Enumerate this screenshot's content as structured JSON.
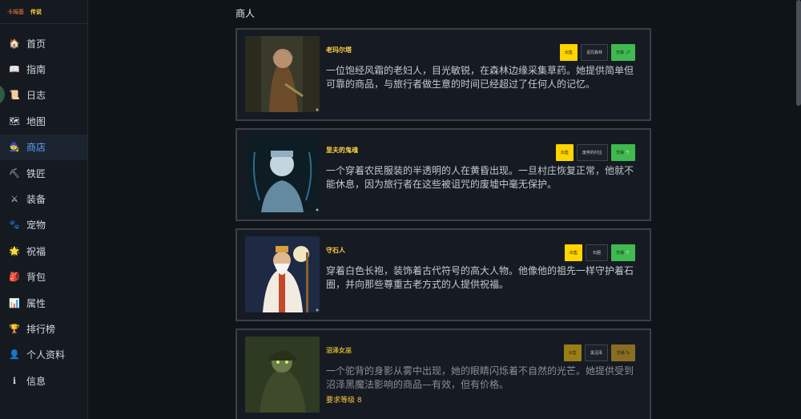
{
  "brand": {
    "name": "卡姆基",
    "rank": "传说"
  },
  "nav": [
    {
      "key": "home",
      "label": "首页",
      "icon": "home-icon",
      "glyph": "🏠"
    },
    {
      "key": "guide",
      "label": "指南",
      "icon": "book-icon",
      "glyph": "📖"
    },
    {
      "key": "log",
      "label": "日志",
      "icon": "scroll-icon",
      "glyph": "📜"
    },
    {
      "key": "map",
      "label": "地图",
      "icon": "map-icon",
      "glyph": "🗺"
    },
    {
      "key": "shop",
      "label": "商店",
      "icon": "merchant-icon",
      "glyph": "🧙",
      "active": true
    },
    {
      "key": "blacksmith",
      "label": "铁匠",
      "icon": "hammer-icon",
      "glyph": "⛏"
    },
    {
      "key": "equipment",
      "label": "装备",
      "icon": "swords-icon",
      "glyph": "⚔"
    },
    {
      "key": "pets",
      "label": "宠物",
      "icon": "paw-icon",
      "glyph": "🐾"
    },
    {
      "key": "blessing",
      "label": "祝福",
      "icon": "sparkle-icon",
      "glyph": "🌟"
    },
    {
      "key": "bag",
      "label": "背包",
      "icon": "backpack-icon",
      "glyph": "🎒"
    },
    {
      "key": "stats",
      "label": "属性",
      "icon": "chart-icon",
      "glyph": "📊"
    },
    {
      "key": "leaderboard",
      "label": "排行榜",
      "icon": "trophy-icon",
      "glyph": "🏆"
    },
    {
      "key": "profile",
      "label": "个人资料",
      "icon": "user-icon",
      "glyph": "👤"
    },
    {
      "key": "info",
      "label": "信息",
      "icon": "info-icon",
      "glyph": "ℹ"
    }
  ],
  "page": {
    "title": "商人"
  },
  "merchants": [
    {
      "name": "老玛尔塔",
      "desc": "一位饱经风霜的老妇人，目光敏锐，在森林边缘采集草药。她提供简单但可靠的商品，与旅行者做生意的时间已经超过了任何人的记忆。",
      "sell": "出售",
      "item": "诅咒森林",
      "trade": "交易 🗡",
      "locked": false
    },
    {
      "name": "里夫的鬼魂",
      "desc": "一个穿着农民服装的半透明的人在黄昏出现。一旦村庄恢复正常，他就不能休息，因为旅行者在这些被诅咒的废墟中毫无保护。",
      "sell": "出售",
      "item": "废弃的村庄",
      "trade": "交易 🍃",
      "locked": false
    },
    {
      "name": "守石人",
      "desc": "穿着白色长袍，装饰着古代符号的高大人物。他像他的祖先一样守护着石圈，并向那些尊重古老方式的人提供祝福。",
      "sell": "出售",
      "item": "石圈",
      "trade": "交易 🍃",
      "locked": false
    },
    {
      "name": "沼泽女巫",
      "desc": "一个驼背的身影从雾中出现，她的眼睛闪烁着不自然的光芒。她提供受到沼泽黑魔法影响的商品—有效，但有价格。",
      "sell": "出售",
      "item": "黑沼泽",
      "trade": "交易 %",
      "locked": true,
      "requirement": "要求等级 8"
    }
  ]
}
